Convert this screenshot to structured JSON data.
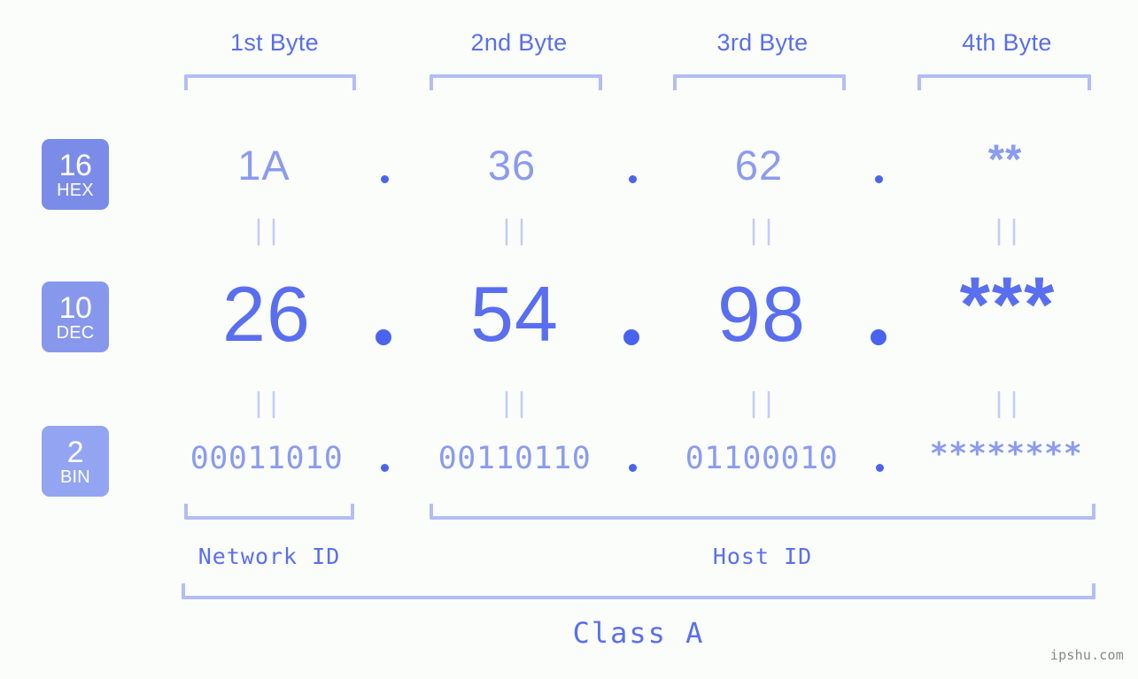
{
  "meta": {
    "background_color": "#fafdfa",
    "accent_color": "#5a6ef0",
    "accent_light_color": "#8b9bf0",
    "bracket_color": "#b3bdf7",
    "watermark": "ipshu.com"
  },
  "headers": [
    {
      "label": "1st Byte"
    },
    {
      "label": "2nd Byte"
    },
    {
      "label": "3rd Byte"
    },
    {
      "label": "4th Byte"
    }
  ],
  "rows": [
    {
      "key": "hex",
      "badge_number": "16",
      "badge_name": "HEX",
      "badge_color": "#7b8ce8",
      "values": [
        "1A",
        "36",
        "62",
        "**"
      ],
      "separator": "."
    },
    {
      "key": "dec",
      "badge_number": "10",
      "badge_name": "DEC",
      "badge_color": "#8798ec",
      "values": [
        "26",
        "54",
        "98",
        "***"
      ],
      "separator": "."
    },
    {
      "key": "bin",
      "badge_number": "2",
      "badge_name": "BIN",
      "badge_color": "#93a5f2",
      "values": [
        "00011010",
        "00110110",
        "01100010",
        "********"
      ],
      "separator": "."
    }
  ],
  "equality_marker": "||",
  "sections": {
    "network_id": "Network ID",
    "host_id": "Host ID",
    "ip_class": "Class A"
  }
}
